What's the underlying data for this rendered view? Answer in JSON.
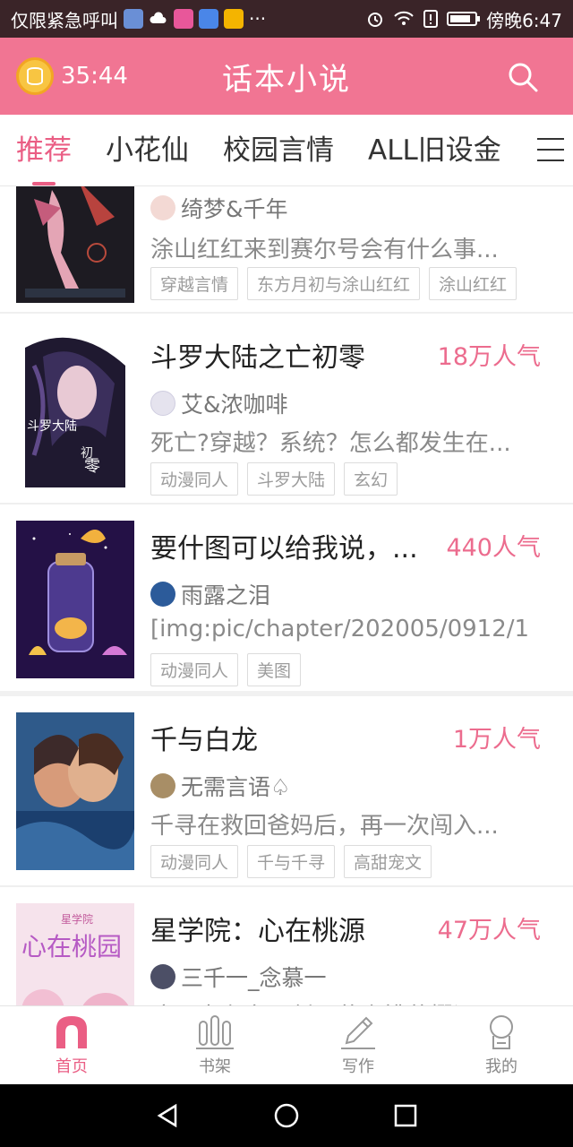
{
  "status_bar": {
    "left_text": "仅限紧急呼叫",
    "more": "···",
    "time": "傍晚6:47",
    "battery_level": 0.85
  },
  "header": {
    "timer": "35:44",
    "title": "话本小说",
    "brand_color": "#f17593"
  },
  "tabs": [
    {
      "label": "推荐",
      "active": true
    },
    {
      "label": "小花仙",
      "active": false
    },
    {
      "label": "校园言情",
      "active": false
    },
    {
      "label": "ALL旧设金",
      "active": false
    }
  ],
  "books": [
    {
      "title": "",
      "popularity": "",
      "author": "绮梦&千年",
      "description": "涂山红红来到赛尔号会有什么事...",
      "tags": [
        "穿越言情",
        "东方月初与涂山红红",
        "涂山红红"
      ]
    },
    {
      "title": "斗罗大陆之亡初零",
      "popularity": "18万人气",
      "author": "艾&浓咖啡",
      "description": "死亡?穿越？系统？怎么都发生在...",
      "tags": [
        "动漫同人",
        "斗罗大陆",
        "玄幻"
      ],
      "cover_text": [
        "斗罗大陆",
        "初",
        "零"
      ]
    },
    {
      "title": "要什图可以给我说，...",
      "popularity": "440人气",
      "author": "雨露之泪",
      "description": "[img:pic/chapter/202005/0912/1",
      "tags": [
        "动漫同人",
        "美图"
      ]
    },
    {
      "title": "千与白龙",
      "popularity": "1万人气",
      "author": "无需言语♤",
      "description": "千寻在救回爸妈后，再一次闯入...",
      "tags": [
        "动漫同人",
        "千与千寻",
        "高甜宠文"
      ]
    },
    {
      "title": "星学院：心在桃源",
      "popularity": "47万人气",
      "author": "三千一_念慕一",
      "description": "这一本主言原创，花小桃蔡樱逗...",
      "tags": [],
      "cover_text": [
        "星学院",
        "心在桃园"
      ]
    }
  ],
  "bottom_nav": [
    {
      "label": "首页",
      "icon": "home-icon",
      "active": true
    },
    {
      "label": "书架",
      "icon": "bookshelf-icon",
      "active": false
    },
    {
      "label": "写作",
      "icon": "pencil-icon",
      "active": false
    },
    {
      "label": "我的",
      "icon": "profile-icon",
      "active": false
    }
  ],
  "colors": {
    "accent": "#ea5e84",
    "popularity": "#ec6c8e",
    "status_bar": "#3a2428"
  }
}
